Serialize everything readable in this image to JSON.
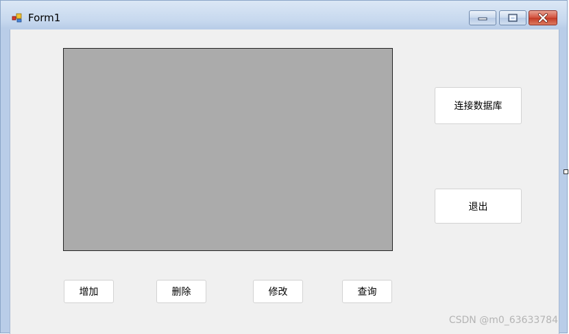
{
  "window": {
    "title": "Form1",
    "icon": "winforms-app-icon"
  },
  "title_controls": {
    "minimize_icon": "minimize-icon",
    "maximize_icon": "maximize-icon",
    "close_icon": "close-icon"
  },
  "buttons": {
    "connect_db": "连接数据库",
    "exit": "退出",
    "add": "增加",
    "delete": "删除",
    "edit": "修改",
    "query": "查询"
  },
  "watermark": "CSDN @m0_63633784",
  "colors": {
    "grid_background": "#ababab",
    "client_background": "#f0f0f0",
    "close_button": "#c9402b"
  }
}
